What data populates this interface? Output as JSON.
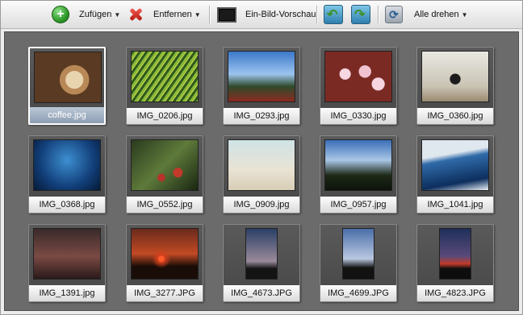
{
  "toolbar": {
    "add_label": "Zufügen",
    "remove_label": "Entfernen",
    "preview_label": "Ein-Bild-Vorschau",
    "rotate_all_label": "Alle drehen"
  },
  "thumbnails": [
    {
      "name": "coffee.jpg",
      "selected": true
    },
    {
      "name": "IMG_0206.jpg"
    },
    {
      "name": "IMG_0293.jpg"
    },
    {
      "name": "IMG_0330.jpg"
    },
    {
      "name": "IMG_0360.jpg"
    },
    {
      "name": "IMG_0368.jpg"
    },
    {
      "name": "IMG_0552.jpg"
    },
    {
      "name": "IMG_0909.jpg"
    },
    {
      "name": "IMG_0957.jpg"
    },
    {
      "name": "IMG_1041.jpg"
    },
    {
      "name": "IMG_1391.jpg"
    },
    {
      "name": "IMG_3277.JPG"
    },
    {
      "name": "IMG_4673.JPG"
    },
    {
      "name": "IMG_4699.JPG"
    },
    {
      "name": "IMG_4823.JPG"
    }
  ]
}
